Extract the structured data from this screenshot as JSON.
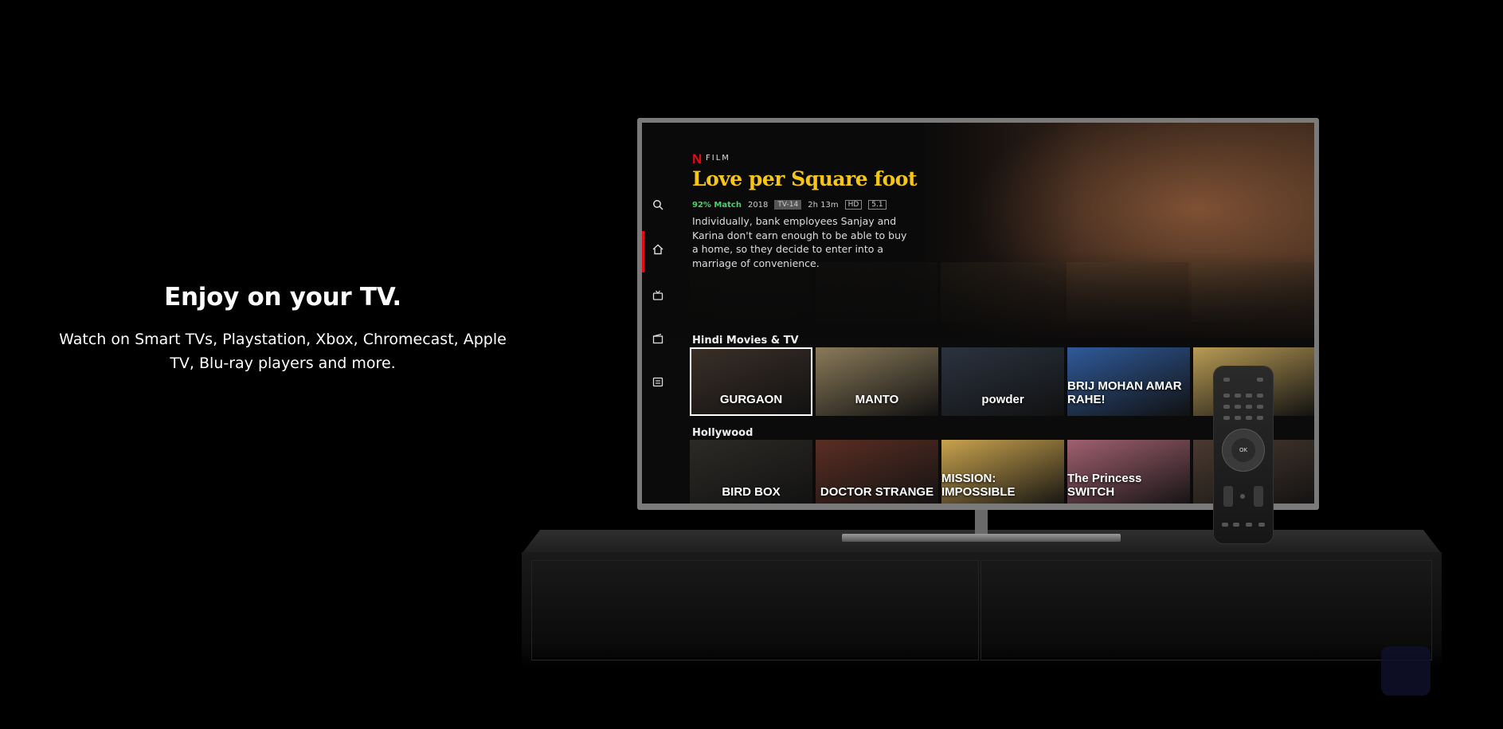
{
  "hero": {
    "title": "Enjoy on your TV.",
    "subtitle": "Watch on Smart TVs, Playstation, Xbox, Chromecast, Apple TV, Blu-ray players and more."
  },
  "tv_screen": {
    "brand_mark": "N",
    "category": "FILM",
    "title": "Love per Square foot",
    "meta": {
      "match": "92% Match",
      "year": "2018",
      "rating": "TV-14",
      "duration": "2h 13m",
      "quality": "HD",
      "audio": "5.1"
    },
    "description": "Individually, bank employees Sanjay and Karina don't earn enough to be able to buy a home, so they decide to enter into a marriage of convenience.",
    "rows": [
      {
        "label": "Hindi Movies & TV",
        "tiles": [
          {
            "label": "GURGAON",
            "color": "#3a2f28"
          },
          {
            "label": "MANTO",
            "color": "#8a7a5a"
          },
          {
            "label": "powder",
            "color": "#2b3340"
          },
          {
            "label": "BRIJ MOHAN AMAR RAHE!",
            "color": "#2f5a9a"
          },
          {
            "label": "",
            "color": "#b89b55"
          }
        ]
      },
      {
        "label": "Hollywood",
        "tiles": [
          {
            "label": "BIRD BOX",
            "color": "#2c2a26"
          },
          {
            "label": "DOCTOR STRANGE",
            "color": "#5a2e24"
          },
          {
            "label": "MISSION: IMPOSSIBLE",
            "color": "#c9a34e"
          },
          {
            "label": "The Princess SWITCH",
            "color": "#a06070"
          },
          {
            "label": "",
            "color": "#4a3a30"
          }
        ]
      }
    ]
  },
  "colors": {
    "accent_red": "#e50914",
    "match_green": "#46d369",
    "title_gold": "#f5c518"
  },
  "remote": {
    "ok_label": "OK"
  }
}
